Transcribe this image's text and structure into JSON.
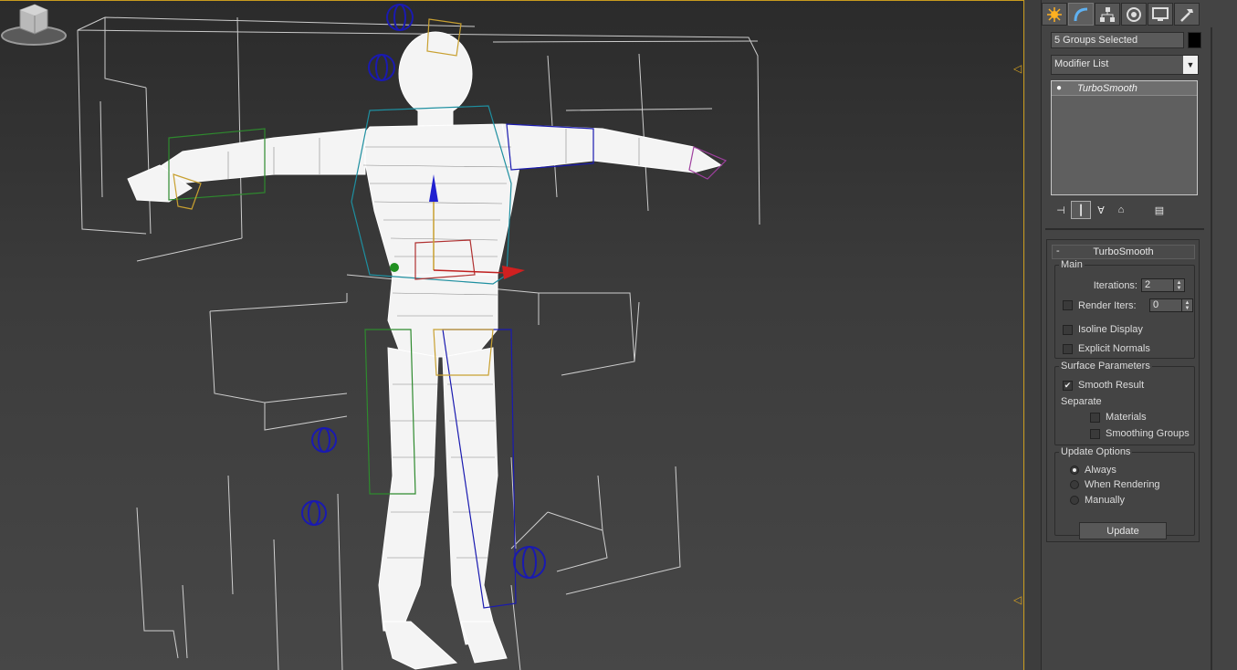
{
  "command_panel": {
    "tabs": [
      {
        "name": "create-tab",
        "icon": "sun-star-icon"
      },
      {
        "name": "modify-tab",
        "icon": "bend-curve-icon"
      },
      {
        "name": "hierarchy-tab",
        "icon": "hierarchy-icon"
      },
      {
        "name": "motion-tab",
        "icon": "motion-circle-icon"
      },
      {
        "name": "display-tab",
        "icon": "monitor-icon"
      },
      {
        "name": "utilities-tab",
        "icon": "hammer-icon"
      }
    ],
    "selection_name": "5 Groups Selected",
    "object_color": "#000000",
    "modifier_list": "Modifier List",
    "stack": [
      {
        "label": "TurboSmooth"
      }
    ]
  },
  "turbosmooth": {
    "title": "TurboSmooth",
    "collapse_symbol": "-",
    "main": {
      "legend": "Main",
      "iterations_label": "Iterations:",
      "iterations_value": "2",
      "render_iters_label": "Render Iters:",
      "render_iters_value": "0",
      "render_iters_checked": false,
      "isoline_display_label": "Isoline Display",
      "isoline_display_checked": false,
      "explicit_normals_label": "Explicit Normals",
      "explicit_normals_checked": false
    },
    "surface": {
      "legend": "Surface Parameters",
      "smooth_result_label": "Smooth Result",
      "smooth_result_checked": true,
      "separate_label": "Separate",
      "materials_label": "Materials",
      "smoothing_groups_label": "Smoothing Groups"
    },
    "update": {
      "legend": "Update Options",
      "options": [
        "Always",
        "When Rendering",
        "Manually"
      ],
      "selected": "Always",
      "update_button": "Update"
    }
  },
  "colors": {
    "viewport_border": "#c89b1e",
    "wireframe": "#ffffff",
    "bone_cyan": "#1e8fa0",
    "bone_green": "#2e8a2e",
    "helper_blue": "#1a1ab0"
  }
}
